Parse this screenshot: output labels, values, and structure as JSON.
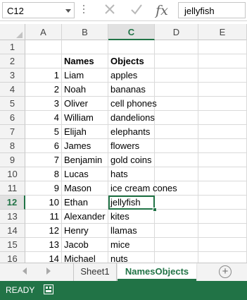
{
  "formula_bar": {
    "name_box": "C12",
    "cancel_icon": "x-icon",
    "enter_icon": "checkmark-icon",
    "fx_label": "fx",
    "formula_value": "jellyfish"
  },
  "columns": [
    "A",
    "B",
    "C",
    "D",
    "E"
  ],
  "selected_column": "C",
  "rows": [
    {
      "n": "1",
      "a": "",
      "b": "",
      "c": ""
    },
    {
      "n": "2",
      "a": "",
      "b": "Names",
      "c": "Objects"
    },
    {
      "n": "3",
      "a": "1",
      "b": "Liam",
      "c": "apples"
    },
    {
      "n": "4",
      "a": "2",
      "b": "Noah",
      "c": "bananas"
    },
    {
      "n": "5",
      "a": "3",
      "b": "Oliver",
      "c": "cell phones"
    },
    {
      "n": "6",
      "a": "4",
      "b": "William",
      "c": "dandelions"
    },
    {
      "n": "7",
      "a": "5",
      "b": "Elijah",
      "c": "elephants"
    },
    {
      "n": "8",
      "a": "6",
      "b": "James",
      "c": "flowers"
    },
    {
      "n": "9",
      "a": "7",
      "b": "Benjamin",
      "c": "gold coins"
    },
    {
      "n": "10",
      "a": "8",
      "b": "Lucas",
      "c": "hats"
    },
    {
      "n": "11",
      "a": "9",
      "b": "Mason",
      "c": "ice cream cones"
    },
    {
      "n": "12",
      "a": "10",
      "b": "Ethan",
      "c": "jellyfish"
    },
    {
      "n": "13",
      "a": "11",
      "b": "Alexander",
      "c": "kites"
    },
    {
      "n": "14",
      "a": "12",
      "b": "Henry",
      "c": "llamas"
    },
    {
      "n": "15",
      "a": "13",
      "b": "Jacob",
      "c": "mice"
    },
    {
      "n": "16",
      "a": "14",
      "b": "Michael",
      "c": "nuts"
    }
  ],
  "active_row": "12",
  "sheet_tabs": [
    {
      "label": "Sheet1",
      "active": false
    },
    {
      "label": "NamesObjects",
      "active": true
    }
  ],
  "add_sheet_icon": "plus-circle-icon",
  "status": {
    "ready": "READY",
    "macro_icon": "macro-record-icon"
  },
  "colors": {
    "accent": "#217346",
    "header_bg": "#f3f3f3",
    "selected_header_bg": "#e1e1e1"
  }
}
